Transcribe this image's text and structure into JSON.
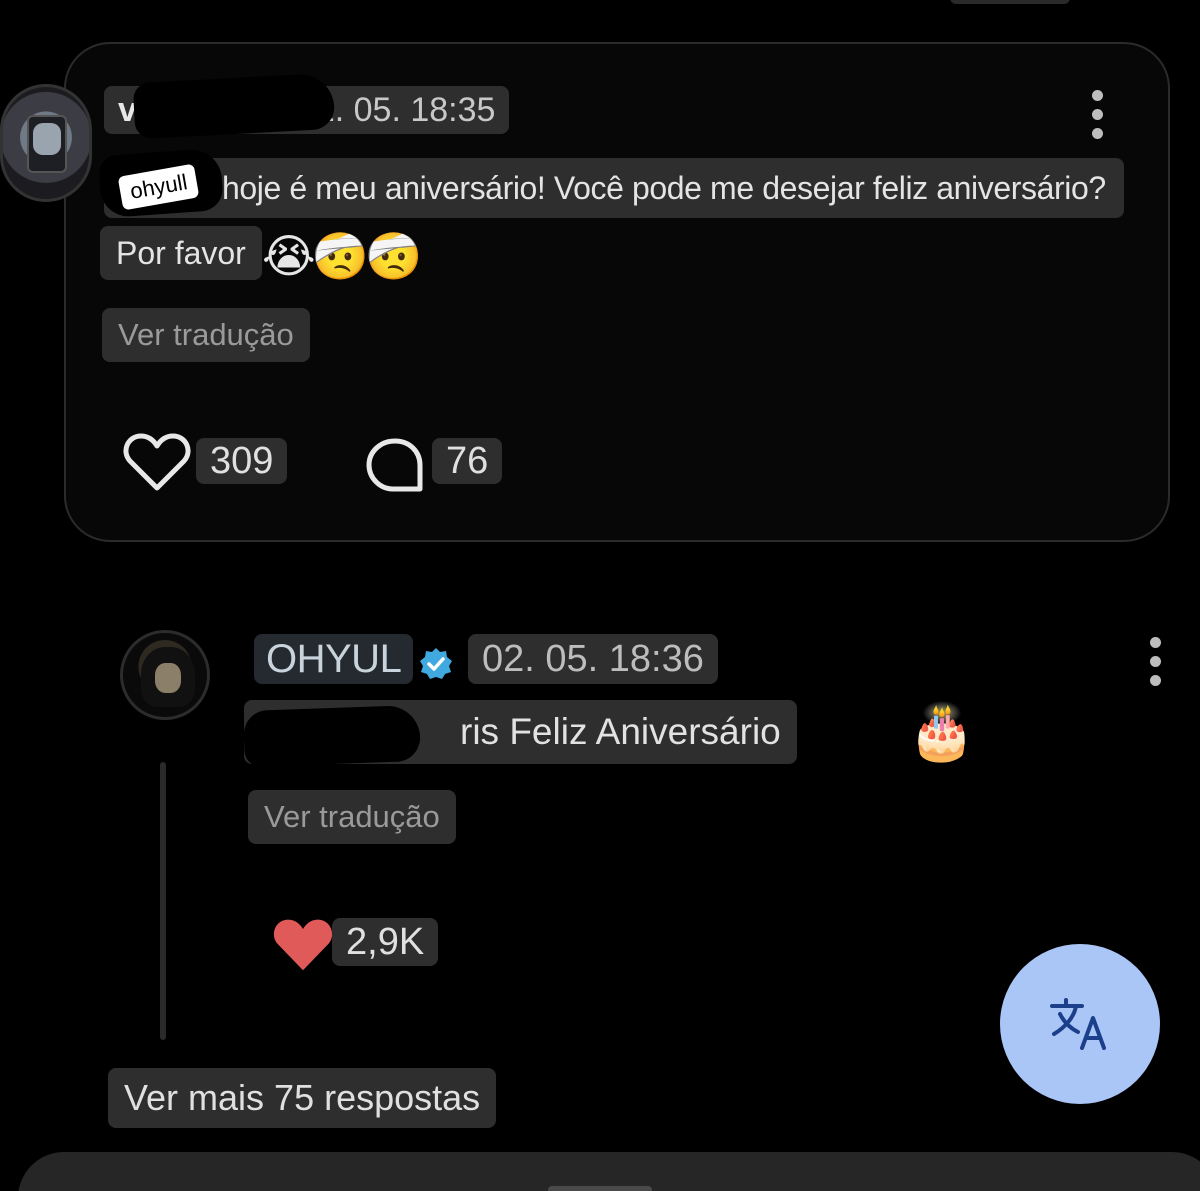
{
  "post": {
    "username": "v",
    "timestamp": "02. 05. 18:35",
    "sticker_text": "ohyull",
    "text_line1": "hoje é meu aniversário! Você pode me desejar feliz aniversário?",
    "text_line2": "Por favor",
    "emojis": "😭🤕🤕",
    "translate_label": "Ver tradução",
    "likes": "309",
    "comments": "76"
  },
  "reply": {
    "username": "OHYUL",
    "verified": true,
    "timestamp": "02. 05. 18:36",
    "mention_prefix": "@",
    "text": "ris Feliz Aniversário",
    "emoji": "🎂",
    "translate_label": "Ver tradução",
    "likes": "2,9K",
    "heart_color": "#e05a5a"
  },
  "more_replies_label": "Ver mais 75 respostas",
  "fab": {
    "icon": "translate-icon",
    "color": "#a9c6f7"
  },
  "verified_color": "#3fa9e0"
}
